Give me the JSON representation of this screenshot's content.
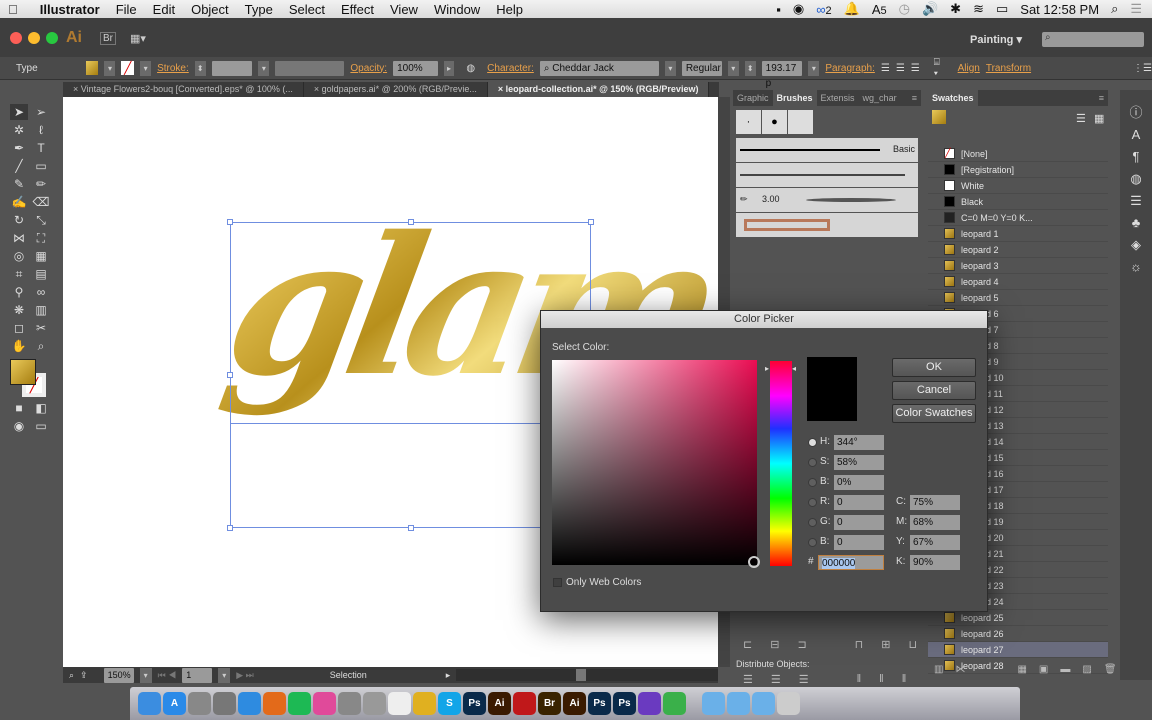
{
  "menubar": {
    "apple": "",
    "app": "Illustrator",
    "items": [
      "File",
      "Edit",
      "Object",
      "Type",
      "Select",
      "Effect",
      "View",
      "Window",
      "Help"
    ],
    "cc_count": "2",
    "adobe_count": "5",
    "clock": "Sat 12:58 PM"
  },
  "appbar": {
    "logo": "Ai",
    "br": "Br",
    "workspace": "Painting"
  },
  "control": {
    "tool": "Type",
    "stroke_label": "Stroke:",
    "opacity_label": "Opacity:",
    "opacity": "100%",
    "character_label": "Character:",
    "font": "Cheddar Jack",
    "style": "Regular",
    "size": "193.17 p",
    "paragraph_label": "Paragraph:",
    "align_label": "Align",
    "transform_label": "Transform"
  },
  "tabs": [
    {
      "label": "Vintage Flowers2-bouq [Converted].eps* @ 100% (..."
    },
    {
      "label": "goldpapers.ai* @ 200% (RGB/Previe..."
    },
    {
      "label": "leopard-collection.ai* @ 150% (RGB/Preview)"
    }
  ],
  "artwork": {
    "text": "glam",
    "fill": "#c9a233"
  },
  "status": {
    "zoom": "150%",
    "artboard": "1",
    "tool": "Selection"
  },
  "brushes": {
    "tabs": [
      "Graphic",
      "Brushes",
      "Extensis",
      "wg_char"
    ],
    "basic": "Basic",
    "size": "3.00",
    "distribute_label": "Distribute Objects:"
  },
  "swatches": {
    "title": "Swatches",
    "items": [
      "[None]",
      "[Registration]",
      "White",
      "Black",
      "C=0 M=0 Y=0 K...",
      "leopard 1",
      "leopard 2",
      "leopard 3",
      "leopard 4",
      "leopard 5",
      "leopard 6",
      "leopard 7",
      "leopard 8",
      "leopard 9",
      "leopard 10",
      "leopard 11",
      "leopard 12",
      "leopard 13",
      "leopard 14",
      "leopard 15",
      "leopard 16",
      "leopard 17",
      "leopard 18",
      "leopard 19",
      "leopard 20",
      "leopard 21",
      "leopard 22",
      "leopard 23",
      "leopard 24",
      "leopard 25",
      "leopard 26",
      "leopard 27",
      "leopard 28"
    ],
    "selected": "leopard 27"
  },
  "picker": {
    "title": "Color Picker",
    "select_label": "Select Color:",
    "ok": "OK",
    "cancel": "Cancel",
    "swatches": "Color Swatches",
    "H": "344°",
    "S": "58%",
    "B": "0%",
    "R": "0",
    "G": "0",
    "Bv": "0",
    "hex": "000000",
    "C": "75%",
    "M": "68%",
    "Y": "67%",
    "K": "90%",
    "web_only": "Only Web Colors",
    "hue_color": "#ea0c52"
  },
  "dock": [
    {
      "n": "finder",
      "c": "#3b8de0",
      "t": ""
    },
    {
      "n": "app-store",
      "c": "#2a8ae8",
      "t": "A"
    },
    {
      "n": "launchpad",
      "c": "#888",
      "t": ""
    },
    {
      "n": "system-prefs",
      "c": "#777",
      "t": ""
    },
    {
      "n": "safari",
      "c": "#2e8be0",
      "t": ""
    },
    {
      "n": "firefox",
      "c": "#e36a1a",
      "t": ""
    },
    {
      "n": "spotify",
      "c": "#1db954",
      "t": ""
    },
    {
      "n": "itunes",
      "c": "#e04a9a",
      "t": ""
    },
    {
      "n": "chrome-canary",
      "c": "#888",
      "t": ""
    },
    {
      "n": "preview",
      "c": "#999",
      "t": ""
    },
    {
      "n": "calendar",
      "c": "#eee",
      "t": ""
    },
    {
      "n": "chrome",
      "c": "#e0b020",
      "t": ""
    },
    {
      "n": "skype",
      "c": "#12a5e8",
      "t": "S"
    },
    {
      "n": "photoshop",
      "c": "#0a2a4a",
      "t": "Ps"
    },
    {
      "n": "illustrator",
      "c": "#3a1a00",
      "t": "Ai"
    },
    {
      "n": "acrobat",
      "c": "#c0181a",
      "t": ""
    },
    {
      "n": "bridge",
      "c": "#3a2400",
      "t": "Br"
    },
    {
      "n": "illustrator-2",
      "c": "#3a1a00",
      "t": "Ai"
    },
    {
      "n": "photoshop-2",
      "c": "#0a2a4a",
      "t": "Ps"
    },
    {
      "n": "photoshop-3",
      "c": "#0a2a4a",
      "t": "Ps"
    },
    {
      "n": "imovie",
      "c": "#6a3ac0",
      "t": ""
    },
    {
      "n": "evernote",
      "c": "#3ab04a",
      "t": ""
    },
    {
      "n": "folder",
      "c": "#6ab0e8",
      "t": ""
    },
    {
      "n": "folder-2",
      "c": "#6ab0e8",
      "t": ""
    },
    {
      "n": "folder-3",
      "c": "#6ab0e8",
      "t": ""
    },
    {
      "n": "trash",
      "c": "#ccc",
      "t": ""
    }
  ]
}
